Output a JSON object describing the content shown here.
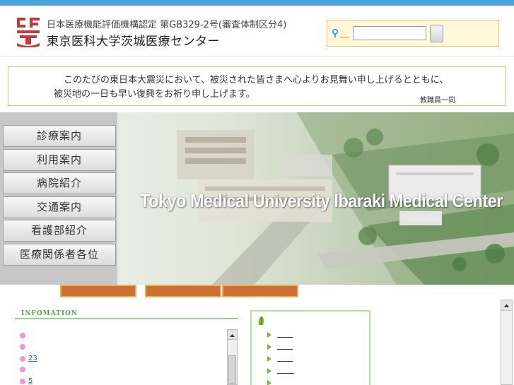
{
  "colors": {
    "accent": "#4aa3df",
    "brand": "#c03a3a",
    "tab": "#cc7033",
    "green": "#4aa84a"
  },
  "header": {
    "accreditation": "日本医療機能評価機構認定 第GB329-2号(審査体制区分4)",
    "hospital_name": "東京医科大学茨城医療センター",
    "logo_icon": "university-crest-icon"
  },
  "search": {
    "value": "",
    "placeholder": "",
    "icon": "key-search-icon"
  },
  "notice": {
    "line1": "このたびの東日本大震災において、被災された皆さまへ心よりお見舞い申し上げるとともに、",
    "line2": "被災地の一日も早い復興をお祈り申し上げます。",
    "signature": "教職員一同"
  },
  "hero": {
    "title": "Tokyo Medical University Ibaraki Medical Center"
  },
  "nav": {
    "items": [
      {
        "label": "診療案内"
      },
      {
        "label": "利用案内"
      },
      {
        "label": "病院紹介"
      },
      {
        "label": "交通案内"
      },
      {
        "label": "看護部紹介"
      },
      {
        "label": "医療関係者各位"
      }
    ]
  },
  "info": {
    "heading": "INFOMATION",
    "items": [
      {
        "text": ""
      },
      {
        "text": ""
      },
      {
        "text": "23"
      },
      {
        "text": ""
      },
      {
        "text": "5"
      }
    ]
  }
}
